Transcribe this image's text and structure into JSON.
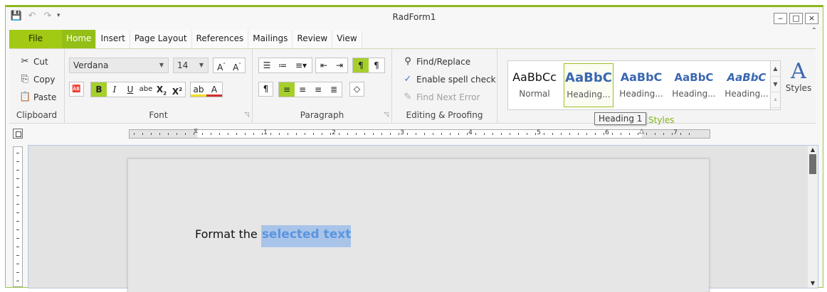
{
  "window": {
    "title": "RadForm1",
    "minimize_glyph": "‒",
    "maximize_glyph": "□",
    "close_glyph": "×",
    "collapse_glyph": "⌃"
  },
  "qat": {
    "save_icon": "💾",
    "undo_icon": "↶",
    "redo_icon": "↷",
    "more_glyph": "▾"
  },
  "tabs": {
    "file": "File",
    "items": [
      "Home",
      "Insert",
      "Page Layout",
      "References",
      "Mailings",
      "Review",
      "View"
    ]
  },
  "clipboard": {
    "label": "Clipboard",
    "cut": "Cut",
    "copy": "Copy",
    "paste": "Paste"
  },
  "font": {
    "label": "Font",
    "family": "Verdana",
    "size": "14",
    "bold": "B",
    "italic": "I",
    "underline": "U",
    "strike": "abe",
    "subscript": "X",
    "superscript": "X"
  },
  "paragraph": {
    "label": "Paragraph"
  },
  "editing": {
    "label": "Editing & Proofing",
    "find_replace": "Find/Replace",
    "spell_check": "Enable spell check",
    "find_next_error": "Find Next Error"
  },
  "styles": {
    "label": "Styles",
    "button_label": "Styles",
    "gallery": [
      {
        "sample": "AaBbCc",
        "name": "Normal"
      },
      {
        "sample": "AaBbC",
        "name": "Heading..."
      },
      {
        "sample": "AaBbC",
        "name": "Heading..."
      },
      {
        "sample": "AaBbC",
        "name": "Heading..."
      },
      {
        "sample": "AaBbC",
        "name": "Heading..."
      }
    ],
    "tooltip": "Heading 1"
  },
  "ruler": {
    "numbers": [
      "1",
      "2",
      "3",
      "4",
      "5",
      "6",
      "7"
    ]
  },
  "document": {
    "text_before": "Format the ",
    "selected_text": "selected text"
  },
  "colors": {
    "accent": "#93bf16",
    "file_tab": "#a2c914",
    "selection": "#a9c4e9",
    "heading_blue": "#3a67b0"
  }
}
